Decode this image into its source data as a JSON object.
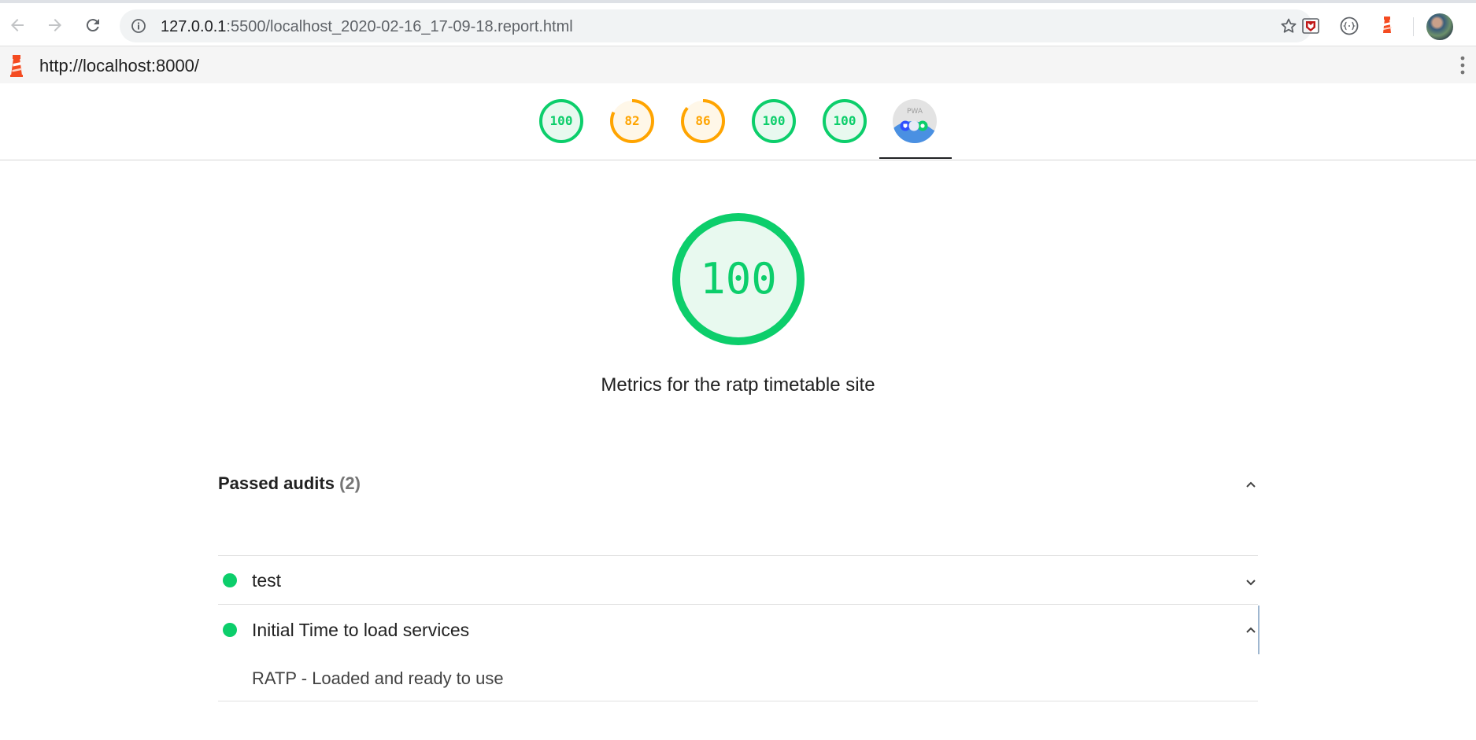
{
  "browser": {
    "url_host": "127.0.0.1",
    "url_rest": ":5500/localhost_2020-02-16_17-09-18.report.html",
    "icons": [
      "back-arrow-icon",
      "forward-arrow-icon",
      "reload-icon",
      "site-info-icon",
      "bookmark-star-icon",
      "mcafee-extension-icon",
      "json-extension-icon",
      "lighthouse-extension-icon",
      "profile-avatar"
    ]
  },
  "report": {
    "url": "http://localhost:8000/",
    "gauges": [
      {
        "score": "100",
        "value": 100,
        "color": "#0cce6b",
        "fill": "#e8f9ef"
      },
      {
        "score": "82",
        "value": 82,
        "color": "#ffa400",
        "fill": "#fff7e8"
      },
      {
        "score": "86",
        "value": 86,
        "color": "#ffa400",
        "fill": "#fff7e8"
      },
      {
        "score": "100",
        "value": 100,
        "color": "#0cce6b",
        "fill": "#e8f9ef"
      },
      {
        "score": "100",
        "value": 100,
        "color": "#0cce6b",
        "fill": "#e8f9ef"
      }
    ],
    "pwa_label": "PWA",
    "category": {
      "score": "100",
      "value": 100,
      "color": "#0cce6b",
      "description": "Metrics for the ratp timetable site"
    },
    "passed": {
      "label": "Passed audits",
      "count": "(2)"
    },
    "audits": [
      {
        "title": "test",
        "expanded": false
      },
      {
        "title": "Initial Time to load services",
        "expanded": true,
        "detail": "RATP - Loaded and ready to use"
      }
    ]
  }
}
